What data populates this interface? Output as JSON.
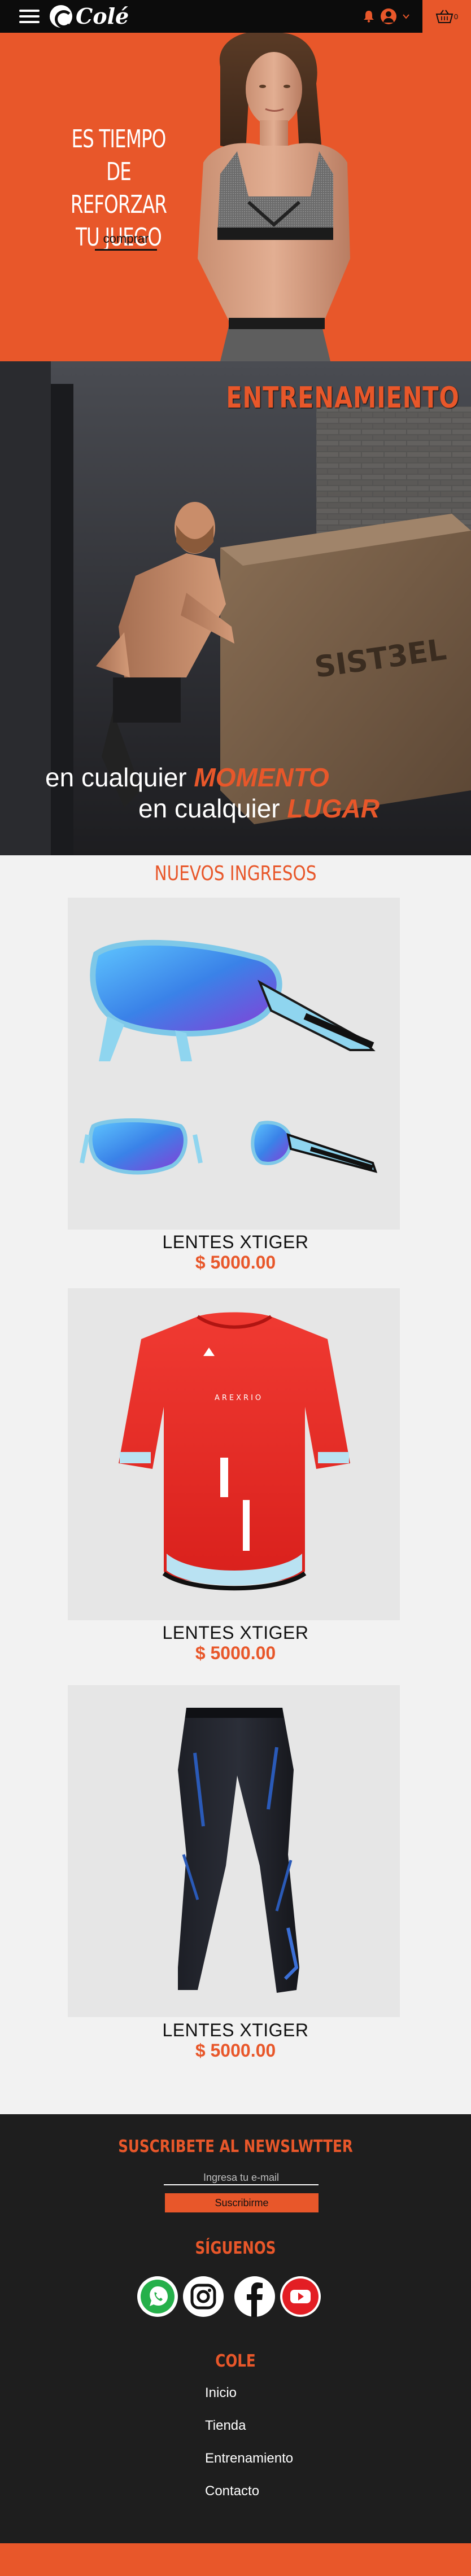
{
  "header": {
    "logo_text": "Colé",
    "cart_count": "0"
  },
  "hero1": {
    "title_line1": "ES TIEMPO",
    "title_line2": "DE REFORZAR",
    "title_line3": "TU JUEGO",
    "cta_label": "comprar"
  },
  "hero2": {
    "headline": "ENTRENAMIENTO",
    "line1_prefix": "en cualquier ",
    "line1_emph": "MOMENTO",
    "line2_prefix": "en cualquier ",
    "line2_emph": "LUGAR"
  },
  "products": {
    "section_title": "NUEVOS INGRESOS",
    "items": [
      {
        "name": "LENTES XTIGER",
        "price": "$ 5000.00",
        "image": "sunglasses-image"
      },
      {
        "name": "LENTES XTIGER",
        "price": "$ 5000.00",
        "image": "cycling-jersey-image"
      },
      {
        "name": "LENTES XTIGER",
        "price": "$ 5000.00",
        "image": "compression-tights-image"
      }
    ]
  },
  "footer": {
    "newsletter_title": "SUSCRIBETE AL NEWSLWTTER",
    "newsletter_placeholder": "Ingresa tu e-mail",
    "newsletter_button": "Suscribirme",
    "follow_title": "SÍGUENOS",
    "social": [
      "whatsapp-icon",
      "instagram-icon",
      "facebook-icon",
      "youtube-icon"
    ],
    "links_title": "COLE",
    "links": [
      "Inicio",
      "Tienda",
      "Entrenamiento",
      "Contacto"
    ]
  },
  "colors": {
    "accent": "#e8572a",
    "dark": "#1e1e1e",
    "topbar": "#0c0c0c",
    "background": "#f2f2f2"
  }
}
